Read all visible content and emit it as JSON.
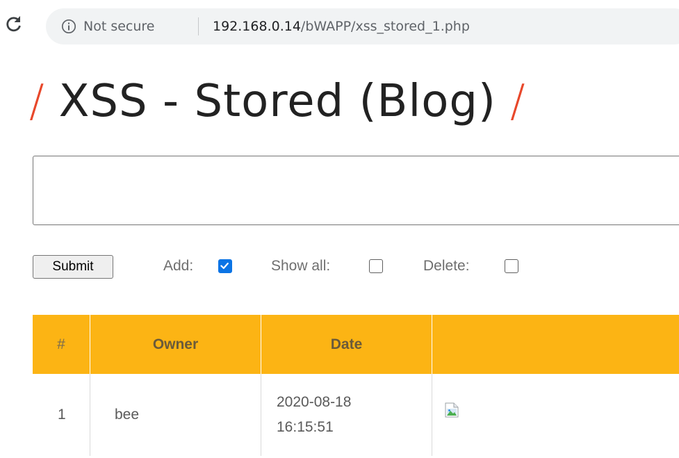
{
  "browser": {
    "security_label": "Not secure",
    "url_host": "192.168.0.14",
    "url_path": "/bWAPP/xss_stored_1.php",
    "icons": [
      "reload-icon",
      "info-icon"
    ]
  },
  "page": {
    "slash_left": "/",
    "title": "XSS - Stored (Blog)",
    "slash_right": "/"
  },
  "form": {
    "entry_value": "",
    "submit_label": "Submit",
    "add_label": "Add:",
    "add_checked": true,
    "show_all_label": "Show all:",
    "show_all_checked": false,
    "delete_label": "Delete:",
    "delete_checked": false,
    "accent_color": "#0b74e5"
  },
  "table": {
    "header_color": "#fcb414",
    "columns": [
      "#",
      "Owner",
      "Date",
      ""
    ],
    "rows": [
      {
        "num": "1",
        "owner": "bee",
        "date_line1": "2020-08-18",
        "date_line2": "16:15:51",
        "entry_icon": "broken-image-icon"
      }
    ]
  }
}
